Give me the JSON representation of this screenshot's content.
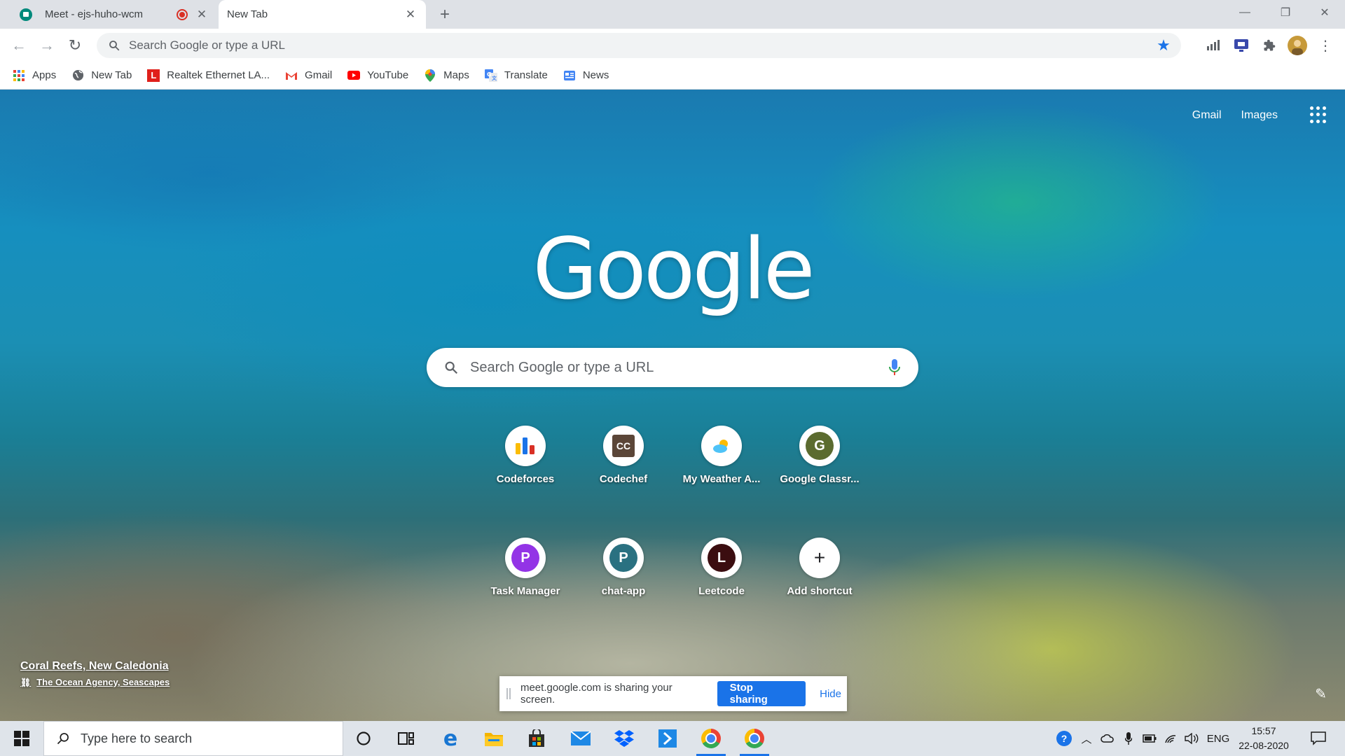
{
  "tabs": [
    {
      "title": "Meet - ejs-huho-wcm",
      "icon": "google-meet-icon",
      "recording": true
    },
    {
      "title": "New Tab",
      "icon": "none"
    }
  ],
  "omnibox": {
    "placeholder": "Search Google or type a URL"
  },
  "bookmarks": [
    {
      "label": "Apps",
      "icon": "apps-grid-icon"
    },
    {
      "label": "New Tab",
      "icon": "globe-icon"
    },
    {
      "label": "Realtek Ethernet LA...",
      "icon": "realtek-icon"
    },
    {
      "label": "Gmail",
      "icon": "gmail-icon"
    },
    {
      "label": "YouTube",
      "icon": "youtube-icon"
    },
    {
      "label": "Maps",
      "icon": "maps-icon"
    },
    {
      "label": "Translate",
      "icon": "translate-icon"
    },
    {
      "label": "News",
      "icon": "news-icon"
    }
  ],
  "page": {
    "top_links": {
      "gmail": "Gmail",
      "images": "Images"
    },
    "logo": "Google",
    "search_placeholder": "Search Google or type a URL",
    "shortcuts": [
      {
        "label": "Codeforces",
        "icon": "codeforces-icon"
      },
      {
        "label": "Codechef",
        "icon": "codechef-icon",
        "text": "CC"
      },
      {
        "label": "My Weather A...",
        "icon": "weather-icon"
      },
      {
        "label": "Google Classr...",
        "icon": "letter-icon",
        "letter": "G",
        "color": "#5b6b2f"
      },
      {
        "label": "Task Manager",
        "icon": "letter-icon",
        "letter": "P",
        "color": "#9334e6"
      },
      {
        "label": "chat-app",
        "icon": "letter-icon",
        "letter": "P",
        "color": "#2a7181"
      },
      {
        "label": "Leetcode",
        "icon": "letter-icon",
        "letter": "L",
        "color": "#3b0d10"
      },
      {
        "label": "Add shortcut",
        "icon": "plus-icon",
        "symbol": "+"
      }
    ],
    "attribution": {
      "title": "Coral Reefs, New Caledonia",
      "credit": "The Ocean Agency, Seascapes"
    }
  },
  "sharebar": {
    "message": "meet.google.com is sharing your screen.",
    "stop_label": "Stop sharing",
    "hide_label": "Hide"
  },
  "taskbar": {
    "search_placeholder": "Type here to search",
    "language": "ENG",
    "time": "15:57",
    "date": "22-08-2020"
  },
  "colors": {
    "accent": "#1a73e8",
    "tabstrip": "#dee1e6",
    "taskbar": "#dfe4ea"
  }
}
